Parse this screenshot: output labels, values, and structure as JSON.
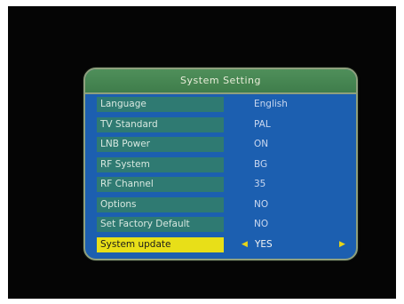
{
  "menu": {
    "title": "System Setting",
    "rows": [
      {
        "label": "Language",
        "value": "English"
      },
      {
        "label": "TV Standard",
        "value": "PAL"
      },
      {
        "label": "LNB Power",
        "value": "ON"
      },
      {
        "label": "RF System",
        "value": "BG"
      },
      {
        "label": "RF Channel",
        "value": "35"
      },
      {
        "label": "Options",
        "value": "NO"
      },
      {
        "label": "Set Factory Default",
        "value": "NO"
      },
      {
        "label": "System update",
        "value": "YES",
        "selected": true
      }
    ]
  },
  "icons": {
    "left_arrow": "triangle-left",
    "right_arrow": "triangle-right"
  },
  "colors": {
    "screen_bg": "#050505",
    "panel_bg": "#1c5fb0",
    "title_bg": "#4f8f5a",
    "label_bg": "#2f7a72",
    "selected_bg": "#e8df18",
    "arrow": "#e8d518"
  }
}
